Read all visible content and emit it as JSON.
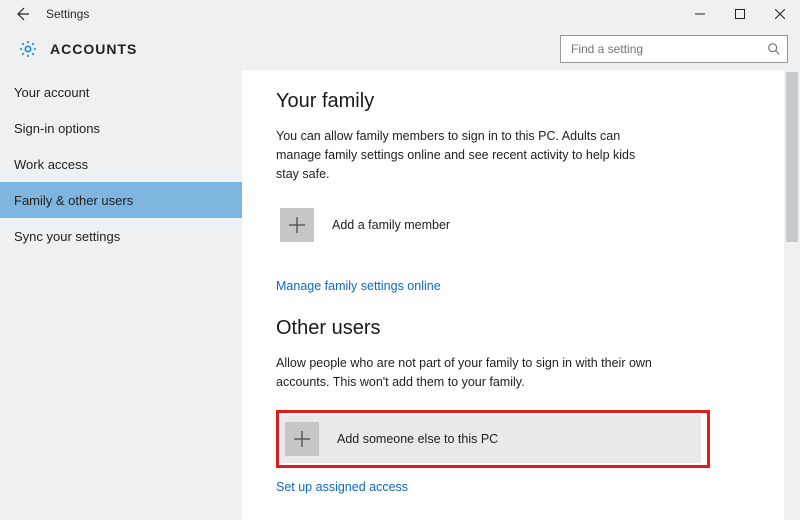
{
  "window": {
    "title": "Settings"
  },
  "header": {
    "page_title": "ACCOUNTS"
  },
  "search": {
    "placeholder": "Find a setting"
  },
  "sidebar": {
    "items": [
      {
        "label": "Your account"
      },
      {
        "label": "Sign-in options"
      },
      {
        "label": "Work access"
      },
      {
        "label": "Family & other users"
      },
      {
        "label": "Sync your settings"
      }
    ]
  },
  "family_section": {
    "heading": "Your family",
    "description": "You can allow family members to sign in to this PC. Adults can manage family settings online and see recent activity to help kids stay safe.",
    "add_label": "Add a family member",
    "manage_link": "Manage family settings online"
  },
  "other_section": {
    "heading": "Other users",
    "description": "Allow people who are not part of your family to sign in with their own accounts. This won't add them to your family.",
    "add_label": "Add someone else to this PC",
    "assigned_link": "Set up assigned access"
  }
}
